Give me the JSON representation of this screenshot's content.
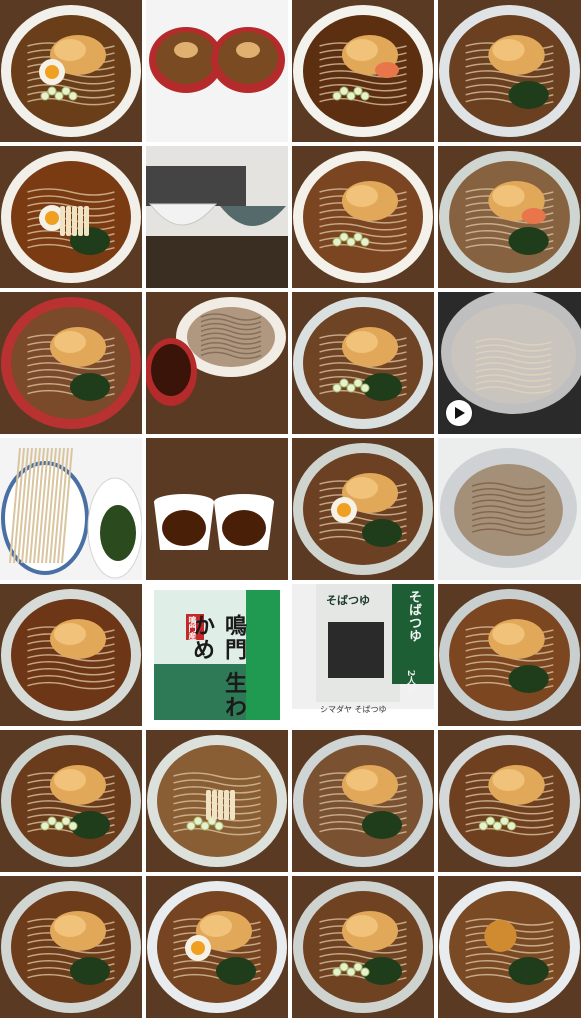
{
  "gallery": {
    "photos": [
      {
        "kind": "bowl",
        "broth": "#6b3e1a",
        "rim": "#f2f0ea",
        "topping": "tempura-egg-scallion"
      },
      {
        "kind": "two-bowls",
        "broth": "#7a4a22",
        "rim": "#b52a2a",
        "topping": "tempura"
      },
      {
        "kind": "bowl",
        "broth": "#5c2f10",
        "rim": "#f4f2ec",
        "topping": "shrimp-tempura-scallion"
      },
      {
        "kind": "bowl",
        "broth": "#6a4020",
        "rim": "#dfe3e6",
        "topping": "tempura-spinach"
      },
      {
        "kind": "bowl",
        "broth": "#7b3b12",
        "rim": "#f2efe8",
        "topping": "egg-udon-seaweed"
      },
      {
        "kind": "empty-bowls",
        "broth": "#e8e6e2",
        "rim": "#ffffff",
        "topping": "none"
      },
      {
        "kind": "bowl",
        "broth": "#7a4520",
        "rim": "#f4f1ea",
        "topping": "tempura-radish"
      },
      {
        "kind": "bowl",
        "broth": "#876240",
        "rim": "#cfd6d2",
        "topping": "shrimp-tempura-wakame"
      },
      {
        "kind": "bowl",
        "broth": "#7b4a2a",
        "rim": "#b83232",
        "topping": "tempura-wakame"
      },
      {
        "kind": "zaru",
        "broth": "#8a6a4a",
        "rim": "#f1ece4",
        "topping": "soba"
      },
      {
        "kind": "bowl",
        "broth": "#6e4424",
        "rim": "#dadfe0",
        "topping": "tempura-wakame-scallion"
      },
      {
        "kind": "pot",
        "broth": "#c9c4bd",
        "rim": "#d9d9d9",
        "topping": "boiling-soba"
      },
      {
        "kind": "dry-noodles",
        "broth": "#d9c6a0",
        "rim": "#ffffff",
        "topping": "wakame"
      },
      {
        "kind": "two-cups",
        "broth": "#4a1f08",
        "rim": "#ffffff",
        "topping": "tsuyu"
      },
      {
        "kind": "bowl",
        "broth": "#6c4022",
        "rim": "#cfd4cf",
        "topping": "egg-kakiage-wakame"
      },
      {
        "kind": "strainer",
        "broth": "#7a5a40",
        "rim": "#cfd2d4",
        "topping": "soba"
      },
      {
        "kind": "bowl",
        "broth": "#6d3616",
        "rim": "#d7dbd8",
        "topping": "kakiage"
      },
      {
        "kind": "package-wakame",
        "broth": "#2f7a56",
        "rim": "#ffffff",
        "topping": "none"
      },
      {
        "kind": "package-soba",
        "broth": "#e5e7e4",
        "rim": "#1d5e35",
        "topping": "none"
      },
      {
        "kind": "bowl",
        "broth": "#7b4620",
        "rim": "#c9cfcf",
        "topping": "kakiage-seaweed"
      },
      {
        "kind": "bowl",
        "broth": "#6a3c1c",
        "rim": "#cdd3cf",
        "topping": "kakiage-scallion-wakame"
      },
      {
        "kind": "bowl",
        "broth": "#8a5e34",
        "rim": "#dde1dc",
        "topping": "udon-scallion"
      },
      {
        "kind": "bowl",
        "broth": "#7a5232",
        "rim": "#cfd4d4",
        "topping": "kakiage-wakame"
      },
      {
        "kind": "bowl",
        "broth": "#6e4020",
        "rim": "#d4d8d8",
        "topping": "tempura-scallion"
      },
      {
        "kind": "bowl",
        "broth": "#6d3c1a",
        "rim": "#d2d6d3",
        "topping": "kakiage-wakame"
      },
      {
        "kind": "bowl",
        "broth": "#764420",
        "rim": "#e8ecef",
        "topping": "kakiage-egg-wakame"
      },
      {
        "kind": "bowl",
        "broth": "#6f4222",
        "rim": "#cfd3d0",
        "topping": "kakiage-wakame-radish"
      },
      {
        "kind": "bowl",
        "broth": "#7a4a24",
        "rim": "#e9ecef",
        "topping": "croquette-spinach"
      }
    ],
    "video_index": 11,
    "play_icon": "play-icon",
    "package_wakame": {
      "vertical_title": "鳴門 生わかめ",
      "tag": "鳴門産"
    },
    "package_soba": {
      "title": "そばつゆ",
      "subtitle": "2人前",
      "price_label": "シマダヤ そばつゆ"
    }
  },
  "colors": {
    "table_wood": "#5a3a22",
    "background": "#ffffff"
  }
}
